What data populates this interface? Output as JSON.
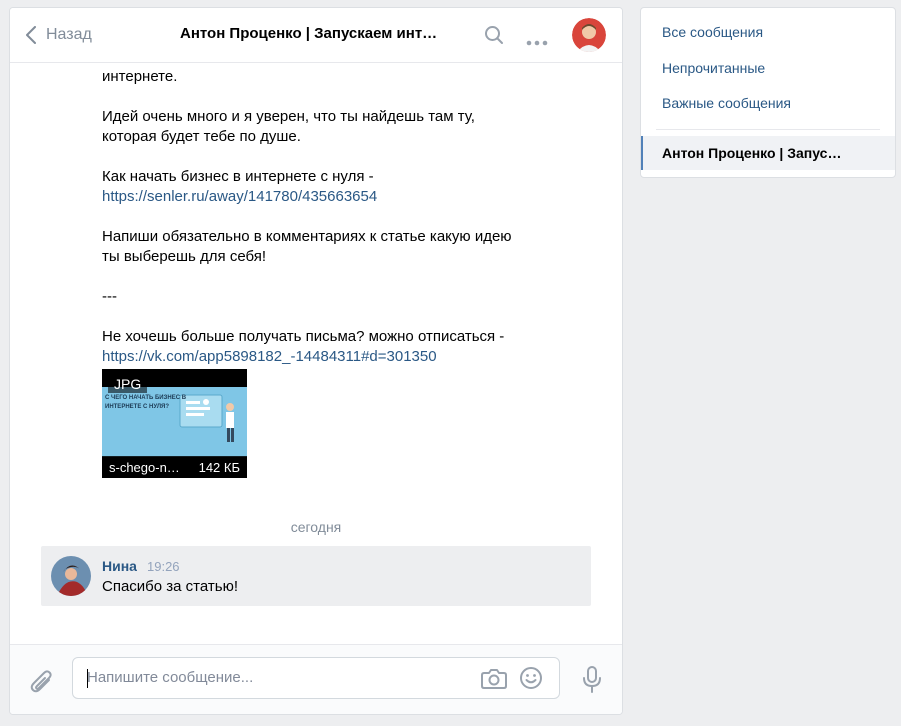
{
  "header": {
    "back_label": "Назад",
    "title": "Антон Проценко | Запускаем инт…"
  },
  "message": {
    "line_top": "интернете.",
    "para1_l1": "Идей очень много и я уверен, что ты найдешь там ту,",
    "para1_l2": "которая будет тебе по душе.",
    "para2_l1": "Как начать бизнес в интернете с нуля -",
    "para2_link": "https://senler.ru/away/141780/435663654",
    "para3_l1": "Напиши обязательно в комментариях к статье какую идею",
    "para3_l2": "ты выберешь для себя!",
    "separator": "---",
    "para4_l1": "Не хочешь больше получать письма? можно отписаться -",
    "para4_link": "https://vk.com/app5898182_-14484311#d=301350",
    "attachment": {
      "type_badge": "JPG",
      "image_caption": "С ЧЕГО НАЧАТЬ БИЗНЕС В ИНТЕРНЕТЕ С НУЛЯ?",
      "filename": "s-chego-n…",
      "size": "142 КБ"
    }
  },
  "day_separator": "сегодня",
  "reply": {
    "author": "Нина",
    "time": "19:26",
    "text": "Спасибо за статью!"
  },
  "composer": {
    "placeholder": "Напишите сообщение..."
  },
  "sidebar": {
    "items": [
      {
        "label": "Все сообщения"
      },
      {
        "label": "Непрочитанные"
      },
      {
        "label": "Важные сообщения"
      }
    ],
    "active_chat": "Антон Проценко | Запус…"
  },
  "colors": {
    "link": "#2a5885",
    "accent": "#5181b8",
    "background": "#edeef0"
  }
}
